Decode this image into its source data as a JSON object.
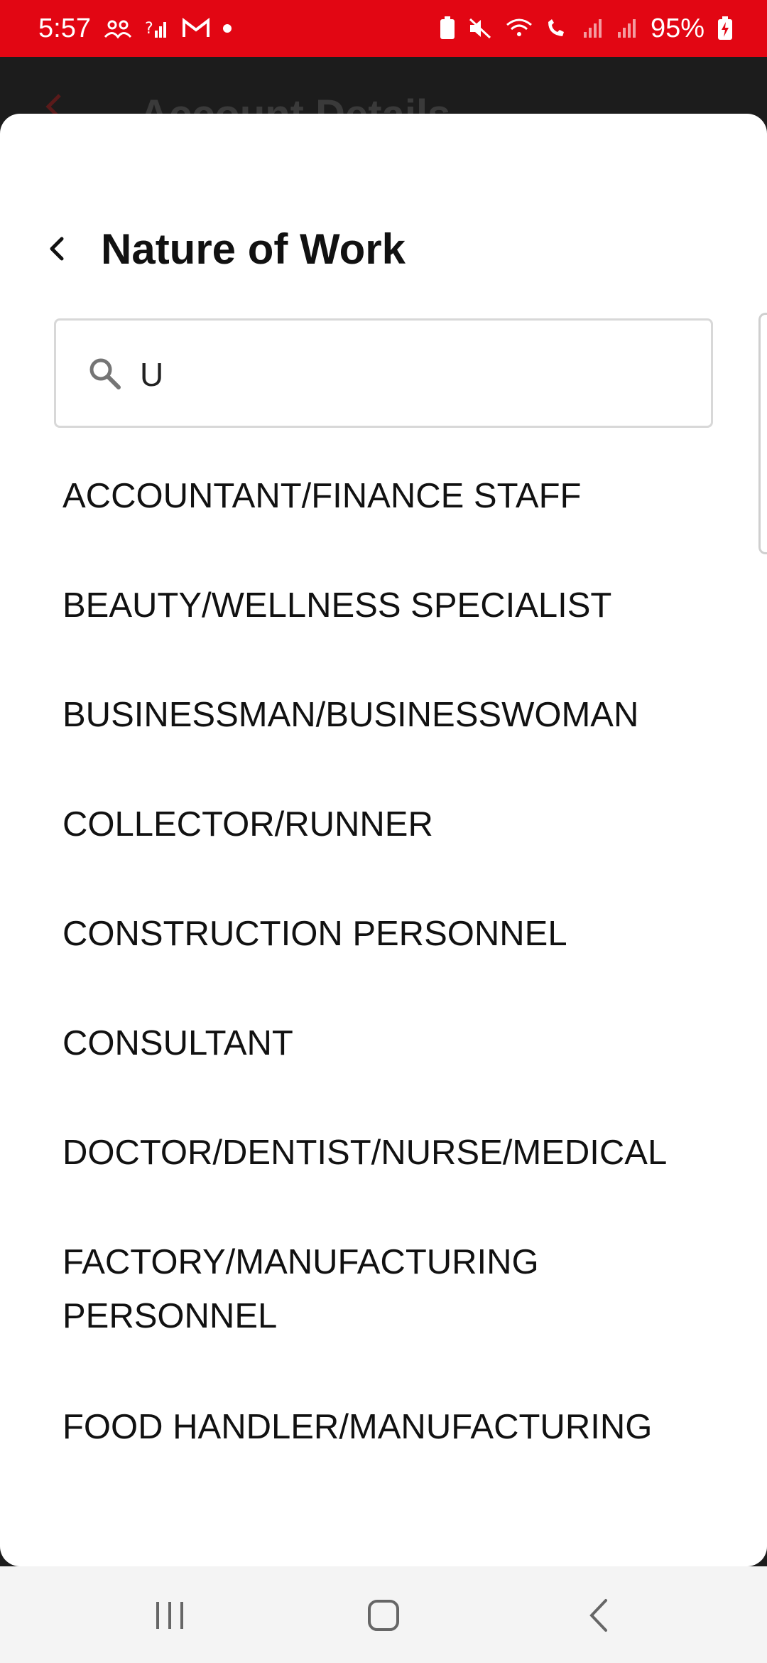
{
  "status_bar": {
    "time": "5:57",
    "battery": "95%"
  },
  "background_screen": {
    "title": "Account Details"
  },
  "sheet": {
    "title": "Nature of Work",
    "search": {
      "value": "U",
      "placeholder": ""
    },
    "items": [
      {
        "label": "ACCOUNTANT/FINANCE STAFF"
      },
      {
        "label": "BEAUTY/WELLNESS SPECIALIST"
      },
      {
        "label": "BUSINESSMAN/BUSINESSWOMAN"
      },
      {
        "label": "COLLECTOR/RUNNER"
      },
      {
        "label": "CONSTRUCTION PERSONNEL"
      },
      {
        "label": "CONSULTANT"
      },
      {
        "label": "DOCTOR/DENTIST/NURSE/MEDICAL"
      },
      {
        "label": "FACTORY/MANUFACTURING\nPERSONNEL"
      },
      {
        "label": "FOOD HANDLER/MANUFACTURING"
      }
    ]
  },
  "colors": {
    "status_bar": "#e20613",
    "sheet_bg": "#ffffff",
    "nav_bg": "#f4f4f4"
  },
  "icons": {
    "back": "chevron-left-icon",
    "search": "search-icon",
    "nav_recents": "recents-icon",
    "nav_home": "home-icon",
    "nav_back": "back-icon"
  }
}
